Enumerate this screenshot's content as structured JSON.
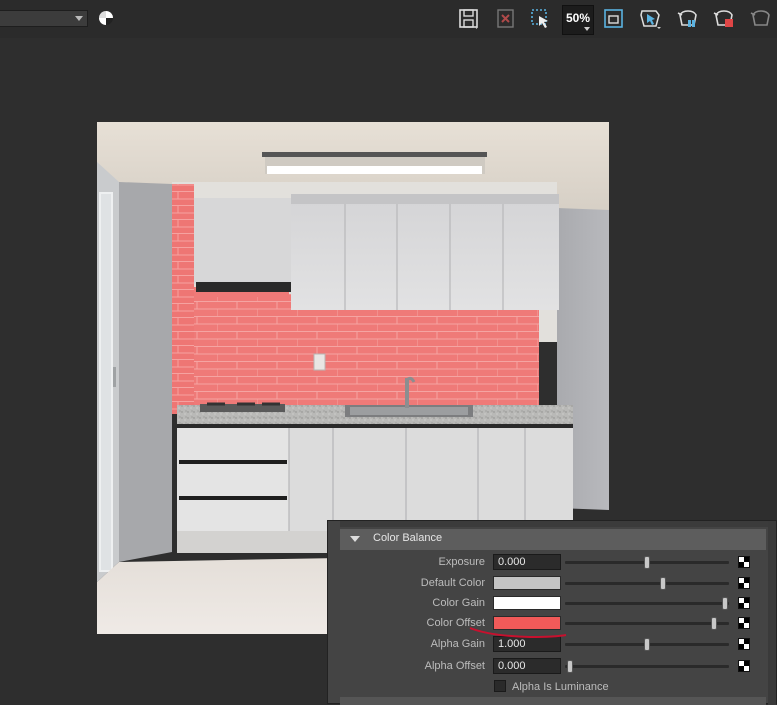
{
  "toolbar": {
    "dropdown_value": "",
    "icons": [
      "color-wheel-icon",
      "save-image-icon",
      "remove-image-icon",
      "region-render-icon",
      "zoom-icon",
      "frame-icon",
      "snapshot-icon",
      "render-camera-icon",
      "ipr-render-icon",
      "stop-render-icon",
      "render-settings-icon"
    ],
    "zoom_label": "50%"
  },
  "render_view": {
    "subject": "kitchen-render"
  },
  "color_balance": {
    "collapsed_section_label": "",
    "title": "Color Balance",
    "rows": [
      {
        "label": "Exposure",
        "value": "0.000",
        "slider": 0.5
      },
      {
        "label": "Default Color",
        "swatch": "#c4c4c4",
        "slider": 0.6
      },
      {
        "label": "Color Gain",
        "swatch": "#ffffff",
        "slider": 0.98
      },
      {
        "label": "Color Offset",
        "swatch": "#f15a59",
        "slider": 0.92
      },
      {
        "label": "Alpha Gain",
        "value": "1.000",
        "slider": 0.5
      },
      {
        "label": "Alpha Offset",
        "value": "0.000",
        "slider": 0.02
      }
    ],
    "checkbox_label": "Alpha Is Luminance"
  },
  "colors": {
    "background": "#2e2e2e",
    "panel": "#444444",
    "accent_annotation": "#c8102e"
  }
}
